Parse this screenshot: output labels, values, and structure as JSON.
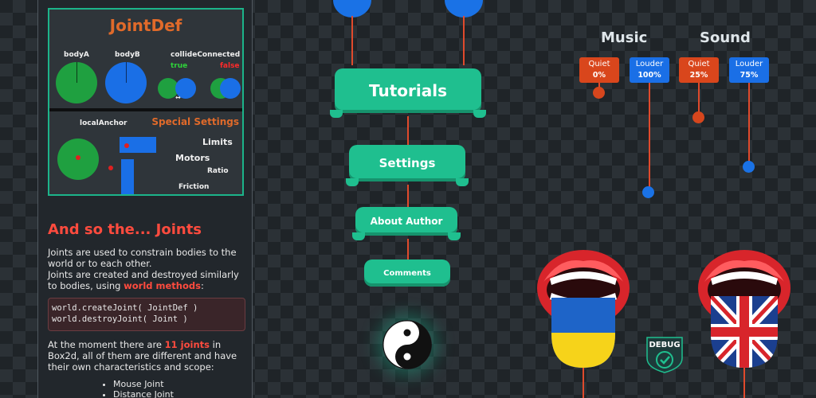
{
  "panel": {
    "jointdef_title": "JointDef",
    "bodyA": "bodyA",
    "bodyB": "bodyB",
    "collide_label": "collideConnected",
    "collide_true": "true",
    "collide_false": "false",
    "local_anchor": "localAnchor",
    "special_settings": "Special Settings",
    "limits": "Limits",
    "motors": "Motors",
    "ratio": "Ratio",
    "friction": "Friction",
    "joints_title": "And so the... Joints",
    "para1": "Joints are used to constrain bodies to the world or to each other.",
    "para2_a": "Joints are created and destroyed similarly to bodies, using ",
    "para2_link": "world methods",
    "para2_b": ":",
    "code1": "world.createJoint( JointDef )",
    "code2": "world.destroyJoint( Joint )",
    "para3_a": "At the moment there are ",
    "para3_hl": "11 joints",
    "para3_b": " in Box2d, all of them are different and have their own characteristics and scope:",
    "list": [
      "Mouse Joint",
      "Distance Joint"
    ]
  },
  "menu": {
    "tutorials": "Tutorials",
    "settings": "Settings",
    "about": "About Author",
    "comments": "Comments"
  },
  "audio": {
    "music_title": "Music",
    "sound_title": "Sound",
    "music_quiet": "Quiet",
    "music_quiet_val": "0%",
    "music_louder": "Louder",
    "music_louder_val": "100%",
    "sound_quiet": "Quiet",
    "sound_quiet_val": "25%",
    "sound_louder": "Louder",
    "sound_louder_val": "75%"
  },
  "debug_label": "DEBUG",
  "icons": {
    "yin_yang": "yin-yang-icon",
    "debug": "debug-badge-icon",
    "flag_ua": "ukraine-flag-icon",
    "flag_uk": "uk-flag-icon"
  },
  "colors": {
    "accent_green": "#1fbf8f",
    "accent_orange": "#d9461c",
    "accent_blue": "#1a6fe6",
    "highlight_red": "#ff4b3e"
  }
}
